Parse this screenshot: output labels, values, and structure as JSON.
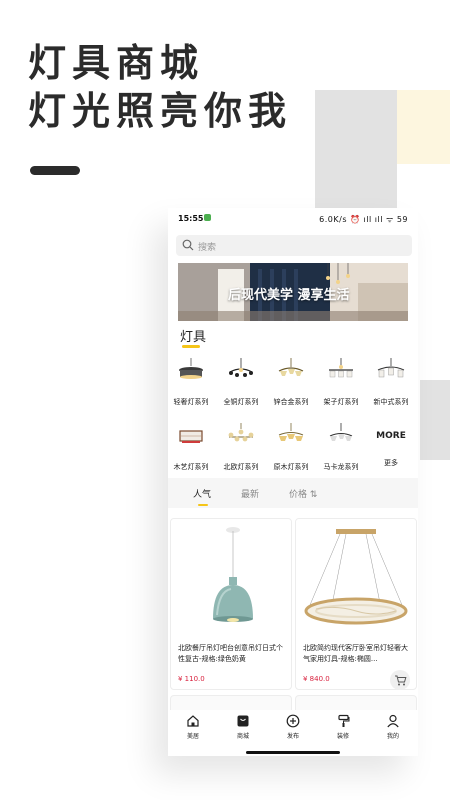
{
  "promo": {
    "line1": "灯具商城",
    "line2": "灯光照亮你我"
  },
  "status": {
    "time": "15:55",
    "right": "6.0K/s ⏰ ıll ıll ᯤ 59"
  },
  "search": {
    "placeholder": "搜索"
  },
  "banner": {
    "text": "后现代美学 漫享生活"
  },
  "section": {
    "title": "灯具"
  },
  "categories": [
    {
      "label": "轻奢灯系列"
    },
    {
      "label": "全铜灯系列"
    },
    {
      "label": "锌合金系列"
    },
    {
      "label": "架子灯系列"
    },
    {
      "label": "新中式系列"
    },
    {
      "label": "木艺灯系列"
    },
    {
      "label": "北欧灯系列"
    },
    {
      "label": "原木灯系列"
    },
    {
      "label": "马卡龙系列"
    },
    {
      "label": "更多",
      "icon_text": "MORE"
    }
  ],
  "tabs": [
    {
      "label": "人气"
    },
    {
      "label": "最新"
    },
    {
      "label": "价格 ⇅"
    }
  ],
  "products": [
    {
      "title": "北欧餐厅吊灯吧台创意吊灯日式个性复古-规格:绿色奶黄",
      "price": "¥ 110.0"
    },
    {
      "title": "北欧简约现代客厅卧室吊灯轻奢大气家用灯具-规格:椭圆...",
      "price": "¥ 840.0"
    }
  ],
  "bottom_nav": [
    {
      "label": "美居",
      "icon": "home-icon"
    },
    {
      "label": "商城",
      "icon": "shop-bag-icon"
    },
    {
      "label": "发布",
      "icon": "add-circle-icon"
    },
    {
      "label": "装修",
      "icon": "paint-roller-icon"
    },
    {
      "label": "我的",
      "icon": "person-icon"
    }
  ],
  "colors": {
    "accent": "#f5c518",
    "price": "#d9223f",
    "text": "#2b2b2b"
  }
}
